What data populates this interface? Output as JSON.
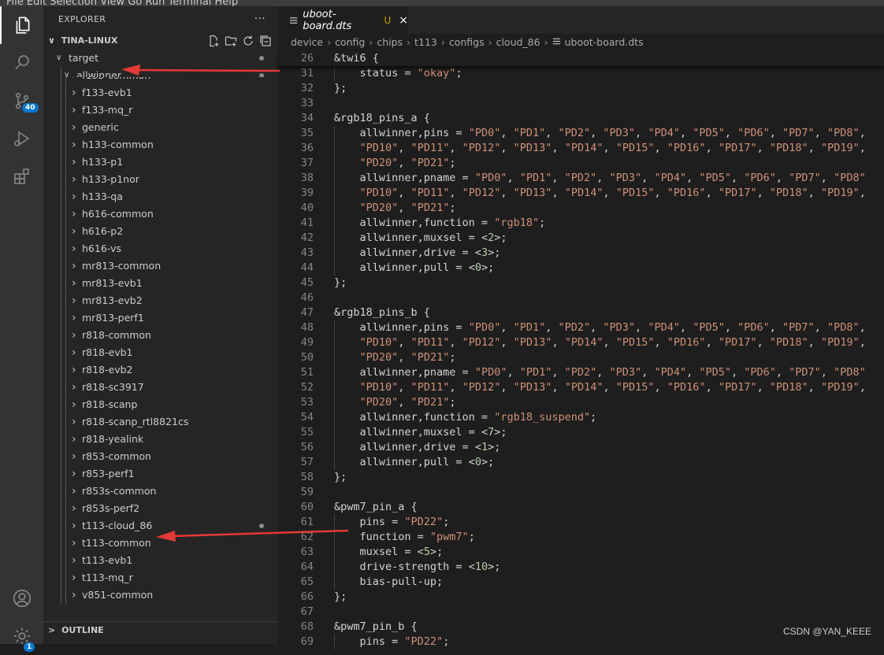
{
  "menubar": {
    "text": "File  Edit  Selection  View  Go  Run  Terminal  Help"
  },
  "activity": {
    "scm_badge": "40",
    "accounts_badge": "1"
  },
  "sidebar": {
    "title": "EXPLORER",
    "more": "···",
    "root": "TINA-LINUX",
    "target": "target",
    "allwinner": "allwinner",
    "items": [
      "f133-common",
      "f133-evb1",
      "f133-mq_r",
      "generic",
      "h133-common",
      "h133-p1",
      "h133-p1nor",
      "h133-qa",
      "h616-common",
      "h616-p2",
      "h616-vs",
      "mr813-common",
      "mr813-evb1",
      "mr813-evb2",
      "mr813-perf1",
      "r818-common",
      "r818-evb1",
      "r818-evb2",
      "r818-sc3917",
      "r818-scanp",
      "r818-scanp_rtl8821cs",
      "r818-yealink",
      "r853-common",
      "r853-perf1",
      "r853s-common",
      "r853s-perf2",
      "t113-cloud_86",
      "t113-common",
      "t113-evb1",
      "t113-mq_r",
      "v851-common"
    ],
    "outline": "OUTLINE"
  },
  "tab": {
    "name": "uboot-board.dts",
    "status": "U",
    "close": "×"
  },
  "breadcrumb": [
    "device",
    "config",
    "chips",
    "t113",
    "configs",
    "cloud_86",
    "uboot-board.dts"
  ],
  "code": {
    "sticky": {
      "num": "26",
      "text": "&twi6 {"
    },
    "lines": [
      {
        "num": "31",
        "text": "    status = \"okay\";"
      },
      {
        "num": "32",
        "text": "};"
      },
      {
        "num": "33",
        "text": ""
      },
      {
        "num": "34",
        "text": "&rgb18_pins_a {"
      },
      {
        "num": "35",
        "text": "    allwinner,pins = \"PD0\", \"PD1\", \"PD2\", \"PD3\", \"PD4\", \"PD5\", \"PD6\", \"PD7\", \"PD8\","
      },
      {
        "num": "36",
        "text": "    \"PD10\", \"PD11\", \"PD12\", \"PD13\", \"PD14\", \"PD15\", \"PD16\", \"PD17\", \"PD18\", \"PD19\","
      },
      {
        "num": "37",
        "text": "    \"PD20\", \"PD21\";"
      },
      {
        "num": "38",
        "text": "    allwinner,pname = \"PD0\", \"PD1\", \"PD2\", \"PD3\", \"PD4\", \"PD5\", \"PD6\", \"PD7\", \"PD8\""
      },
      {
        "num": "39",
        "text": "    \"PD10\", \"PD11\", \"PD12\", \"PD13\", \"PD14\", \"PD15\", \"PD16\", \"PD17\", \"PD18\", \"PD19\","
      },
      {
        "num": "40",
        "text": "    \"PD20\", \"PD21\";"
      },
      {
        "num": "41",
        "text": "    allwinner,function = \"rgb18\";"
      },
      {
        "num": "42",
        "text": "    allwinner,muxsel = <2>;"
      },
      {
        "num": "43",
        "text": "    allwinner,drive = <3>;"
      },
      {
        "num": "44",
        "text": "    allwinner,pull = <0>;"
      },
      {
        "num": "45",
        "text": "};"
      },
      {
        "num": "46",
        "text": ""
      },
      {
        "num": "47",
        "text": "&rgb18_pins_b {"
      },
      {
        "num": "48",
        "text": "    allwinner,pins = \"PD0\", \"PD1\", \"PD2\", \"PD3\", \"PD4\", \"PD5\", \"PD6\", \"PD7\", \"PD8\","
      },
      {
        "num": "49",
        "text": "    \"PD10\", \"PD11\", \"PD12\", \"PD13\", \"PD14\", \"PD15\", \"PD16\", \"PD17\", \"PD18\", \"PD19\","
      },
      {
        "num": "50",
        "text": "    \"PD20\", \"PD21\";"
      },
      {
        "num": "51",
        "text": "    allwinner,pname = \"PD0\", \"PD1\", \"PD2\", \"PD3\", \"PD4\", \"PD5\", \"PD6\", \"PD7\", \"PD8\""
      },
      {
        "num": "52",
        "text": "    \"PD10\", \"PD11\", \"PD12\", \"PD13\", \"PD14\", \"PD15\", \"PD16\", \"PD17\", \"PD18\", \"PD19\","
      },
      {
        "num": "53",
        "text": "    \"PD20\", \"PD21\";"
      },
      {
        "num": "54",
        "text": "    allwinner,function = \"rgb18_suspend\";"
      },
      {
        "num": "55",
        "text": "    allwinner,muxsel = <7>;"
      },
      {
        "num": "56",
        "text": "    allwinner,drive = <1>;"
      },
      {
        "num": "57",
        "text": "    allwinner,pull = <0>;"
      },
      {
        "num": "58",
        "text": "};"
      },
      {
        "num": "59",
        "text": ""
      },
      {
        "num": "60",
        "text": "&pwm7_pin_a {"
      },
      {
        "num": "61",
        "text": "    pins = \"PD22\";"
      },
      {
        "num": "62",
        "text": "    function = \"pwm7\";"
      },
      {
        "num": "63",
        "text": "    muxsel = <5>;"
      },
      {
        "num": "64",
        "text": "    drive-strength = <10>;"
      },
      {
        "num": "65",
        "text": "    bias-pull-up;"
      },
      {
        "num": "66",
        "text": "};"
      },
      {
        "num": "67",
        "text": ""
      },
      {
        "num": "68",
        "text": "&pwm7_pin_b {"
      },
      {
        "num": "69",
        "text": "    pins = \"PD22\";"
      }
    ]
  },
  "watermark": "CSDN @YAN_KEEE",
  "colors": {
    "accent": "#0078d4",
    "string": "#ce9178",
    "number": "#b5cea8",
    "arrow": "#e53935"
  }
}
